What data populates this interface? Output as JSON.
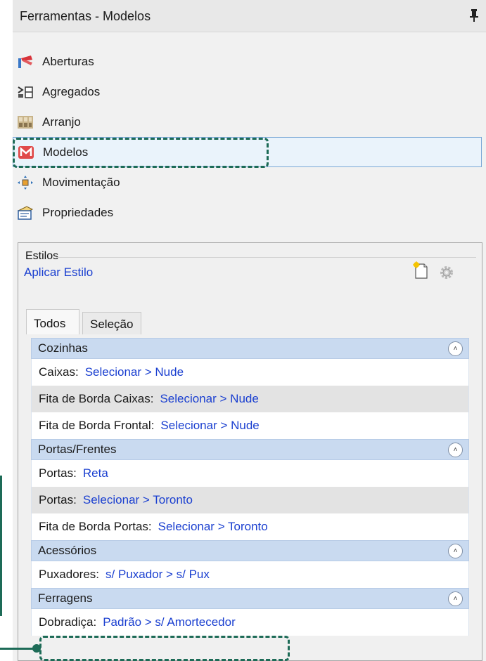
{
  "window": {
    "title": "Ferramentas - Modelos"
  },
  "menu": {
    "items": [
      {
        "label": "Aberturas",
        "icon": "aberturas-icon"
      },
      {
        "label": "Agregados",
        "icon": "agregados-icon"
      },
      {
        "label": "Arranjo",
        "icon": "arranjo-icon"
      },
      {
        "label": "Modelos",
        "icon": "modelos-icon",
        "selected": true
      },
      {
        "label": "Movimentação",
        "icon": "movimentacao-icon"
      },
      {
        "label": "Propriedades",
        "icon": "propriedades-icon"
      }
    ]
  },
  "styles": {
    "group_label": "Estilos",
    "apply_label": "Aplicar Estilo"
  },
  "tabs": [
    {
      "label": "Todos",
      "active": true
    },
    {
      "label": "Seleção",
      "active": false
    }
  ],
  "sections": [
    {
      "title": "Cozinhas",
      "rows": [
        {
          "key": "Caixas:",
          "value": "Selecionar > Nude"
        },
        {
          "key": "Fita de Borda Caixas:",
          "value": "Selecionar > Nude"
        },
        {
          "key": "Fita de Borda Frontal:",
          "value": "Selecionar > Nude"
        }
      ]
    },
    {
      "title": "Portas/Frentes",
      "rows": [
        {
          "key": "Portas:",
          "value": "Reta"
        },
        {
          "key": "Portas:",
          "value": "Selecionar > Toronto"
        },
        {
          "key": "Fita de Borda Portas:",
          "value": "Selecionar > Toronto"
        }
      ]
    },
    {
      "title": "Acessórios",
      "rows": [
        {
          "key": "Puxadores:",
          "value": "s/ Puxador > s/ Pux"
        }
      ]
    },
    {
      "title": "Ferragens",
      "rows": [
        {
          "key": "Dobradiça:",
          "value": "Padrão > s/ Amortecedor"
        }
      ]
    }
  ],
  "colors": {
    "link": "#1a3fd0",
    "section_header": "#c9daf0",
    "highlight": "#1d6b57",
    "selected_bg": "#eaf3fb"
  }
}
